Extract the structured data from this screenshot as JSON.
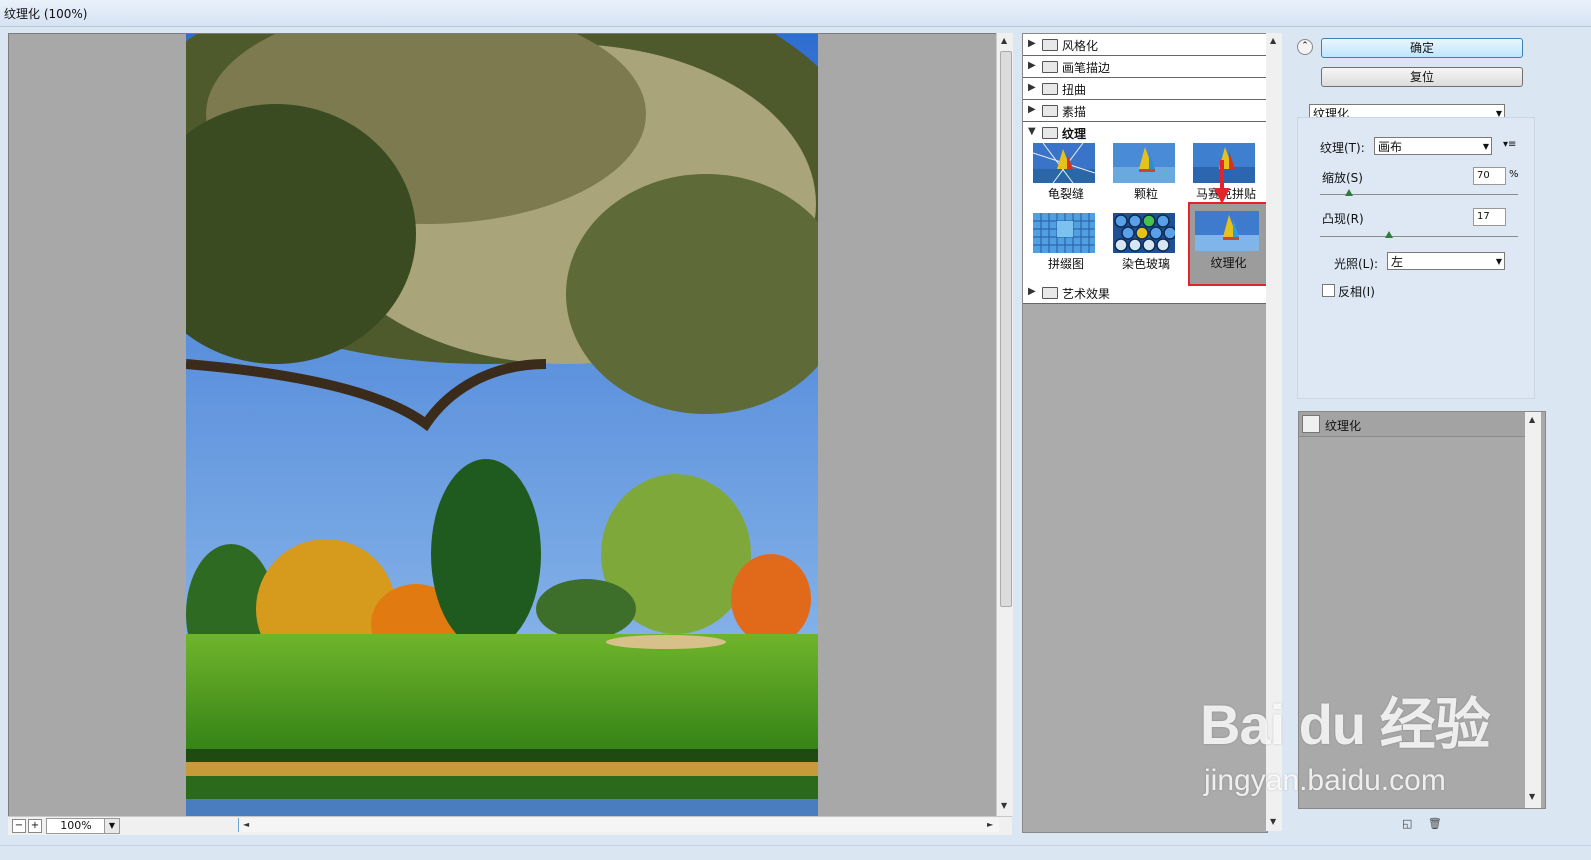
{
  "window": {
    "title": "纹理化 (100%)"
  },
  "preview": {
    "zoom": "100%"
  },
  "gallery": {
    "categories_top": [
      "风格化",
      "画笔描边",
      "扭曲",
      "素描"
    ],
    "open_category": "纹理",
    "filters": [
      "龟裂缝",
      "颗粒",
      "马赛克拼贴",
      "拼缀图",
      "染色玻璃",
      "纹理化"
    ],
    "selected_filter": "纹理化",
    "categories_bottom": [
      "艺术效果"
    ]
  },
  "controls": {
    "ok_label": "确定",
    "reset_label": "复位",
    "filter_select": "纹理化",
    "texture_label": "纹理(T):",
    "texture_value": "画布",
    "scale_label": "缩放(S)",
    "scale_value": "70",
    "scale_unit": "%",
    "relief_label": "凸现(R)",
    "relief_value": "17",
    "light_label": "光照(L):",
    "light_value": "左",
    "invert_label": "反相(I)",
    "invert_checked": false
  },
  "layers": {
    "items": [
      "纹理化"
    ]
  },
  "watermark": {
    "logo_text": "Bai du 经验",
    "url_text": "jingyan.baidu.com"
  }
}
